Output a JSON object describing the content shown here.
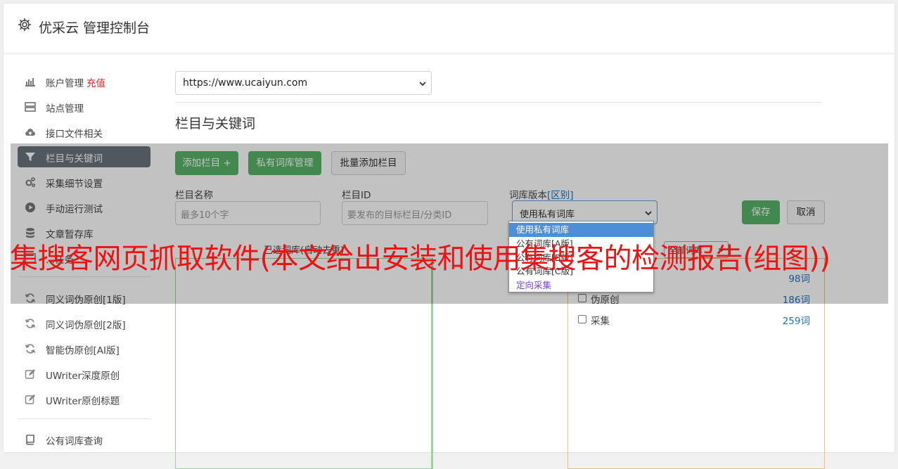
{
  "app": {
    "title": "优采云 管理控制台"
  },
  "sidebar": {
    "items": [
      {
        "label": "账户管理",
        "extra": "充值",
        "icon": "bar-chart-icon"
      },
      {
        "label": "站点管理",
        "icon": "server-icon"
      },
      {
        "label": "接口文件相关",
        "icon": "cloud-upload-icon"
      },
      {
        "label": "栏目与关键词",
        "icon": "filter-icon",
        "active": true
      },
      {
        "label": "采集细节设置",
        "icon": "cogs-icon"
      },
      {
        "label": "手动运行测试",
        "icon": "play-circle-icon"
      },
      {
        "label": "文章暂存库",
        "icon": "database-icon"
      },
      {
        "label": "...任务",
        "icon": "tasks-icon"
      },
      {
        "label": "同义词伪原创[1版]",
        "icon": "refresh-icon"
      },
      {
        "label": "同义词伪原创[2版]",
        "icon": "refresh-icon"
      },
      {
        "label": "智能伪原创[AI版]",
        "icon": "refresh-icon"
      },
      {
        "label": "UWriter深度原创",
        "icon": "edit-icon"
      },
      {
        "label": "UWriter原创标题",
        "icon": "edit-icon"
      },
      {
        "label": "公有词库查询",
        "icon": "book-icon"
      }
    ]
  },
  "main": {
    "site_select": {
      "value": "https://www.ucaiyun.com"
    },
    "section_title": "栏目与关键词",
    "buttons": {
      "add_column": "添加栏目 +",
      "private_lib": "私有词库管理",
      "batch_add": "批量添加栏目",
      "save": "保存",
      "cancel": "取消"
    },
    "fields": {
      "column_name_label": "栏目名称",
      "column_name_placeholder": "最多10个字",
      "column_id_label": "栏目ID",
      "column_id_placeholder": "要发布的目标栏目/分类ID",
      "lib_version_label": "词库版本",
      "lib_version_link": "[区别]",
      "lib_version_value": "使用私有词库"
    },
    "dropdown_options": [
      {
        "label": "使用私有词库",
        "selected": true
      },
      {
        "label": "公有词库[A版]"
      },
      {
        "label": "公有词库[B版]"
      },
      {
        "label": "公有词库[C版]"
      },
      {
        "label": "定向采集",
        "purple": true
      }
    ],
    "selected_col_header": "已选词库(自动去重)",
    "filter_select": "全部词库",
    "library_rows": [
      {
        "name": "",
        "count": "98词"
      },
      {
        "name": "伪原创",
        "count": "186词"
      },
      {
        "name": "采集",
        "count": "259词"
      }
    ]
  },
  "banner": {
    "text": "集搜客网页抓取软件(本文给出安装和使用集搜客的检测报告(组图))"
  }
}
